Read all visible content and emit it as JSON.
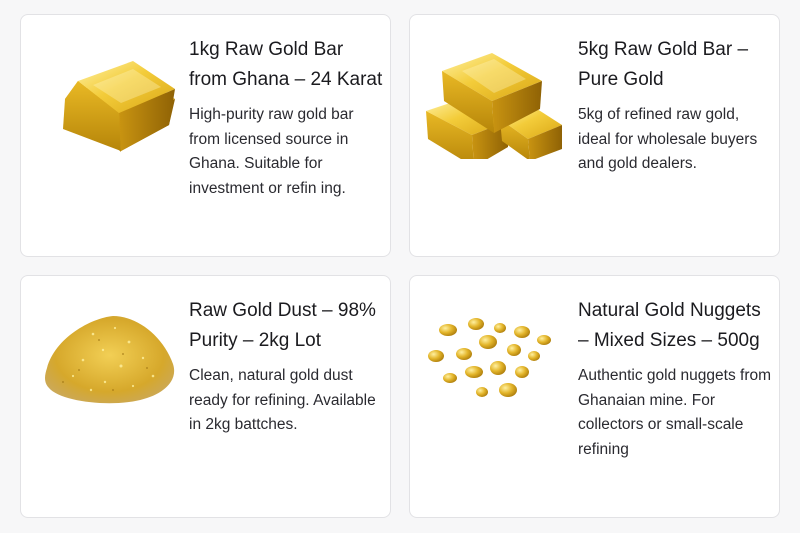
{
  "products": [
    {
      "title": "1kg Raw Gold Bar from Ghana – 24 Karat",
      "description": "High-purity raw gold bar from licensed source in Ghana. Suitable for investment or refin ing.",
      "icon": "gold-bar-icon"
    },
    {
      "title": "5kg Raw Gold Bar – Pure Gold",
      "description": "5kg of refined raw gold, ideal for wholesale buyers and gold dealers.",
      "icon": "stacked-gold-bars-icon"
    },
    {
      "title": "Raw Gold Dust – 98% Purity – 2kg Lot",
      "description": "Clean, natural gold dust ready for refining. Available in 2kg battches.",
      "icon": "gold-dust-icon"
    },
    {
      "title": "Natural Gold Nuggets – Mixed Sizes – 500g",
      "description": "Authentic gold nuggets from Ghanaian mine. For collectors or small-scale refining",
      "icon": "gold-nuggets-icon"
    }
  ],
  "colors": {
    "background": "#f7f7f8",
    "card": "#ffffff",
    "border": "#e2e2e5",
    "gold_light": "#fbe27a",
    "gold_mid": "#e0b320",
    "gold_dark": "#a8780a"
  }
}
